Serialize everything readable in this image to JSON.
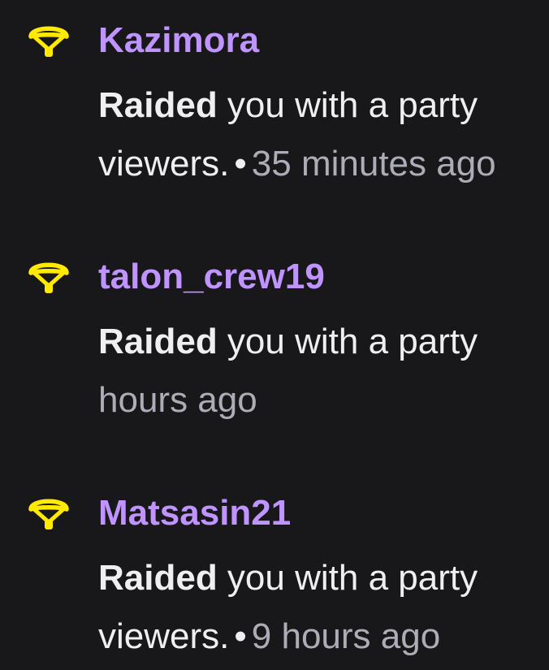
{
  "icons": {
    "raid": "parachute-raid-icon"
  },
  "colors": {
    "background": "#18181b",
    "username": "#bf94ff",
    "raid_icon": "#ffea00",
    "text": "#efeff1",
    "timestamp": "#adadb8"
  },
  "events": [
    {
      "username": "Kazimora",
      "action": "Raided",
      "text_visible": " you with a party ",
      "text_cont": "viewers.",
      "separator": "•",
      "time": "35 minutes ago"
    },
    {
      "username": "talon_crew19",
      "action": "Raided",
      "text_visible": " you with a party ",
      "text_cont": "",
      "separator": "",
      "time": "hours ago"
    },
    {
      "username": "Matsasin21",
      "action": "Raided",
      "text_visible": " you with a party ",
      "text_cont": "viewers.",
      "separator": "•",
      "time": "9 hours ago"
    }
  ]
}
